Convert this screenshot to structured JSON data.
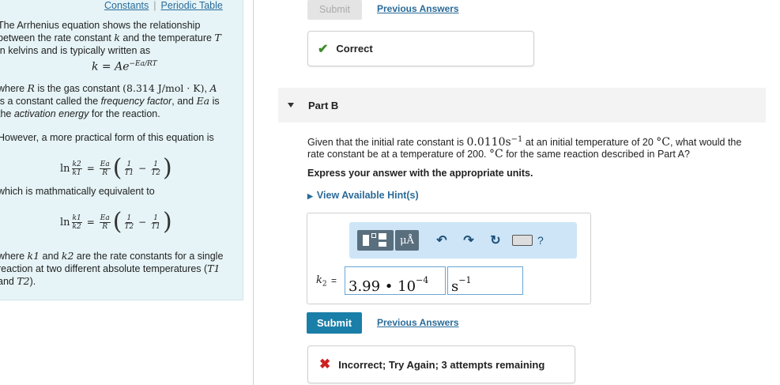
{
  "left_panel": {
    "links": {
      "constants": "Constants",
      "separator": "|",
      "periodic_table": "Periodic Table"
    },
    "intro": {
      "line1": "The Arrhenius equation shows the relationship",
      "line2a": "between the rate constant ",
      "k": "k",
      "line2b": " and the temperature ",
      "T": "T",
      "line3": "in kelvins and is typically written as"
    },
    "equation_main": {
      "lhs": "k = Ae",
      "exp": "−Ea/RT"
    },
    "where_r": {
      "p1": "where ",
      "R": "R",
      "p2": " is the gas constant ",
      "gas_const": "(8.314 J/mol · K)",
      "p3": ", ",
      "A": "A",
      "line2a": "is a constant called the ",
      "freq": "frequency factor",
      "line2b": ", and ",
      "Ea": "Ea",
      "line2c": " is",
      "line3a": "the ",
      "act": "activation energy",
      "line3b": " for the reaction."
    },
    "practical": "However, a more practical form of this equation is",
    "eq1": {
      "ln": "ln",
      "n1": "k2",
      "d1": "k1",
      "eq": "=",
      "n2": "Ea",
      "d2": "R",
      "n3": "1",
      "d3": "T1",
      "minus": "−",
      "n4": "1",
      "d4": "T2"
    },
    "equivalent": "which is mathmatically equivalent to",
    "eq2": {
      "ln": "ln",
      "n1": "k1",
      "d1": "k2",
      "eq": "=",
      "n2": "Ea",
      "d2": "R",
      "n3": "1",
      "d3": "T2",
      "minus": "−",
      "n4": "1",
      "d4": "T1"
    },
    "where_k": {
      "p1": "where ",
      "k1": "k1",
      "p2": " and ",
      "k2": "k2",
      "p3": " are the rate constants for a single",
      "line2a": "reaction at two different absolute temperatures (",
      "T1": "T1",
      "line3a": "and ",
      "T2": "T2",
      "line3b": ")."
    }
  },
  "top": {
    "submit_label": "Submit",
    "previous_answers": "Previous Answers"
  },
  "feedback_correct": "Correct",
  "part_b": {
    "label": "Part B",
    "question_a": "Given that the initial rate constant is ",
    "rate_value": "0.0110s",
    "rate_exp": "−1",
    "question_b": " at an initial temperature of 20 ",
    "unit_c1": "°C",
    "question_c": ", what would the",
    "question_d": "rate constant be at a temperature of 200. ",
    "unit_c2": "°C",
    "question_e": " for the same reaction described in Part A?",
    "instruction": "Express your answer with the appropriate units.",
    "hints": "View Available Hint(s)"
  },
  "toolbar": {
    "units_label": "μÅ",
    "undo": "↶",
    "redo": "↷",
    "reset": "↻",
    "help": "?"
  },
  "answer": {
    "k_label": "k",
    "k_sub": "2",
    "equals": "=",
    "value": "3.99 • 10",
    "value_exp": "−4",
    "unit": "s",
    "unit_exp": "−1"
  },
  "bottom": {
    "submit_label": "Submit",
    "previous_answers": "Previous Answers"
  },
  "feedback_incorrect": "Incorrect; Try Again; 3 attempts remaining"
}
